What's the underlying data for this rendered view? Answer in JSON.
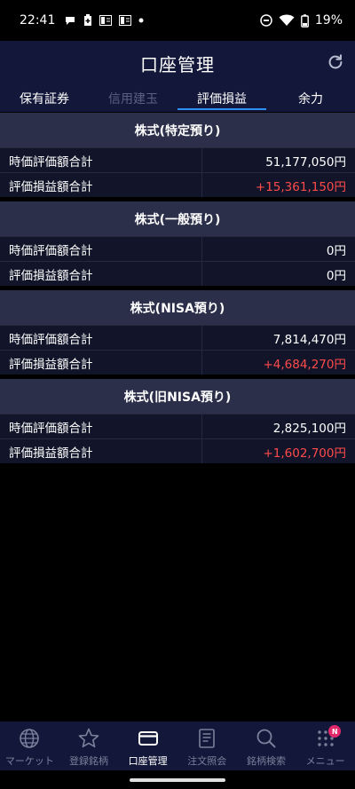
{
  "status_bar": {
    "time": "22:41",
    "battery": "19%",
    "icons_left": [
      "chat-icon",
      "battery-saver-icon",
      "gallery-icon",
      "gallery-icon",
      "dot-icon"
    ],
    "icons_right": [
      "dnd-icon",
      "wifi-icon",
      "battery-icon"
    ]
  },
  "header": {
    "title": "口座管理",
    "refresh_icon": "refresh-icon"
  },
  "tabs": [
    {
      "label": "保有証券",
      "state": "normal"
    },
    {
      "label": "信用建玉",
      "state": "disabled"
    },
    {
      "label": "評価損益",
      "state": "active"
    },
    {
      "label": "余力",
      "state": "normal"
    }
  ],
  "sections": [
    {
      "title": "株式(特定預り)",
      "rows": [
        {
          "label": "時価評価額合計",
          "value": "51,177,050円",
          "color": "#ffffff"
        },
        {
          "label": "評価損益額合計",
          "value": "+15,361,150円",
          "color": "#ff4a4a"
        }
      ]
    },
    {
      "title": "株式(一般預り)",
      "rows": [
        {
          "label": "時価評価額合計",
          "value": "0円",
          "color": "#ffffff"
        },
        {
          "label": "評価損益額合計",
          "value": "0円",
          "color": "#ffffff"
        }
      ]
    },
    {
      "title": "株式(NISA預り)",
      "rows": [
        {
          "label": "時価評価額合計",
          "value": "7,814,470円",
          "color": "#ffffff"
        },
        {
          "label": "評価損益額合計",
          "value": "+4,684,270円",
          "color": "#ff4a4a"
        }
      ]
    },
    {
      "title": "株式(旧NISA預り)",
      "rows": [
        {
          "label": "時価評価額合計",
          "value": "2,825,100円",
          "color": "#ffffff"
        },
        {
          "label": "評価損益額合計",
          "value": "+1,602,700円",
          "color": "#ff4a4a"
        }
      ]
    }
  ],
  "bottom_nav": [
    {
      "label": "マーケット",
      "icon": "globe-icon",
      "active": false
    },
    {
      "label": "登録銘柄",
      "icon": "star-icon",
      "active": false
    },
    {
      "label": "口座管理",
      "icon": "card-icon",
      "active": true
    },
    {
      "label": "注文照会",
      "icon": "document-icon",
      "active": false
    },
    {
      "label": "銘柄検索",
      "icon": "search-icon",
      "active": false
    },
    {
      "label": "メニュー",
      "icon": "grid-icon",
      "active": false,
      "badge": "N"
    }
  ],
  "colors": {
    "accent": "#2f8ff0",
    "header_bg": "#13183a",
    "section_bg": "#2b2f4a",
    "positive": "#ff4a4a",
    "badge": "#e0286b"
  }
}
